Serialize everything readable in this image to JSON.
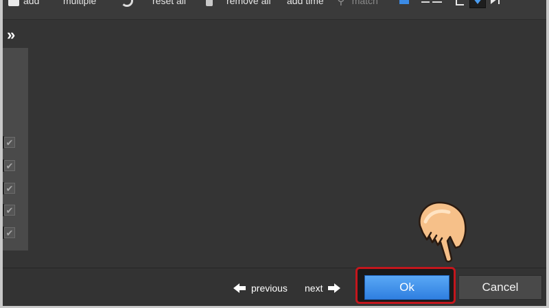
{
  "toolbar": {
    "items": [
      {
        "label": "add",
        "icon": "add-icon"
      },
      {
        "label": "multiple",
        "icon": ""
      },
      {
        "label": "reset all",
        "icon": "undo-icon"
      },
      {
        "label": "remove all",
        "icon": "trash-icon"
      },
      {
        "label": "add time",
        "icon": ""
      },
      {
        "label": "match",
        "icon": "link-icon"
      }
    ]
  },
  "sidebar": {
    "expand_glyph": "»",
    "checkboxes": [
      {
        "checked": true
      },
      {
        "checked": true
      },
      {
        "checked": true
      },
      {
        "checked": true
      },
      {
        "checked": true
      }
    ],
    "check_glyph": "✔"
  },
  "footer": {
    "previous_label": "previous",
    "next_label": "next",
    "ok_label": "Ok",
    "cancel_label": "Cancel"
  },
  "colors": {
    "accent": "#3b8be6",
    "highlight": "#c4161c",
    "background": "#343434"
  }
}
